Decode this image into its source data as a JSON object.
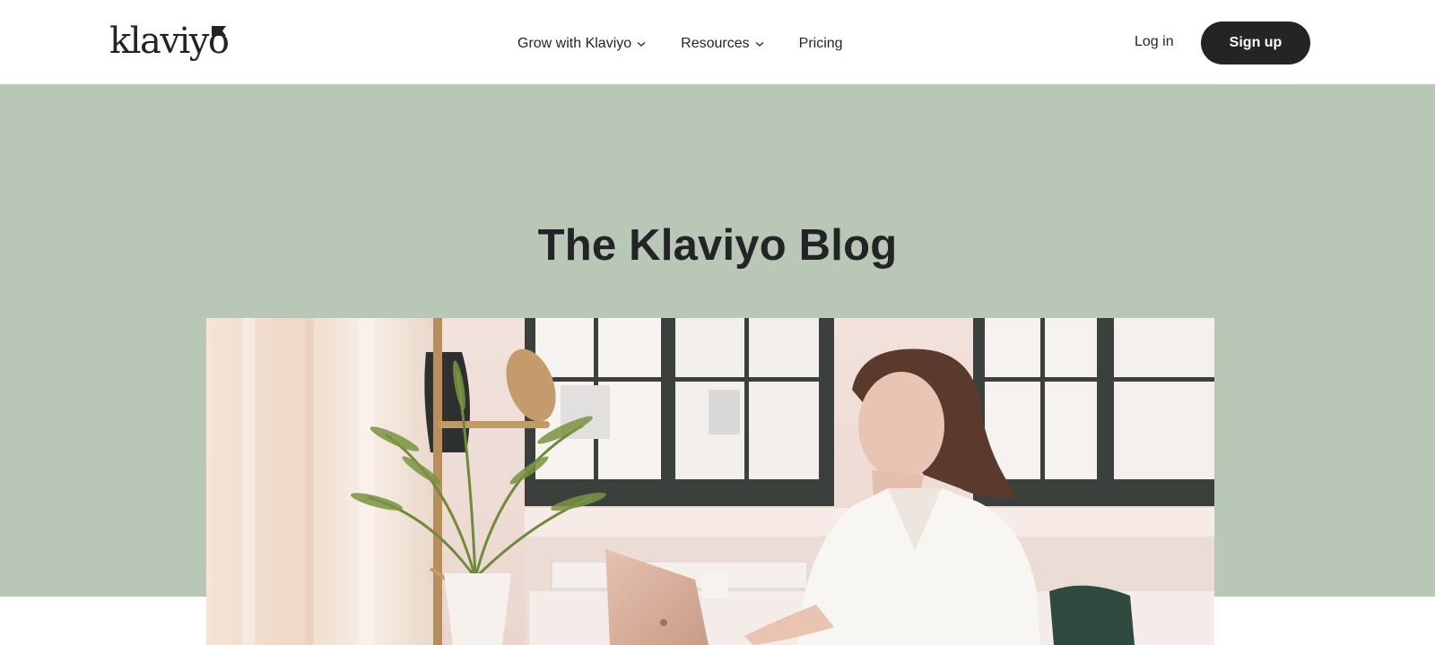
{
  "header": {
    "logo_text": "klaviyo",
    "nav": [
      {
        "label": "Grow with Klaviyo",
        "has_dropdown": true
      },
      {
        "label": "Resources",
        "has_dropdown": true
      },
      {
        "label": "Pricing",
        "has_dropdown": false
      }
    ],
    "login_label": "Log in",
    "signup_label": "Sign up"
  },
  "hero": {
    "title": "The Klaviyo Blog",
    "background_color": "#b9c7b6"
  },
  "colors": {
    "text": "#232426",
    "button_bg": "#232426",
    "button_text": "#ffffff",
    "hero_bg": "#b9c7b6"
  }
}
